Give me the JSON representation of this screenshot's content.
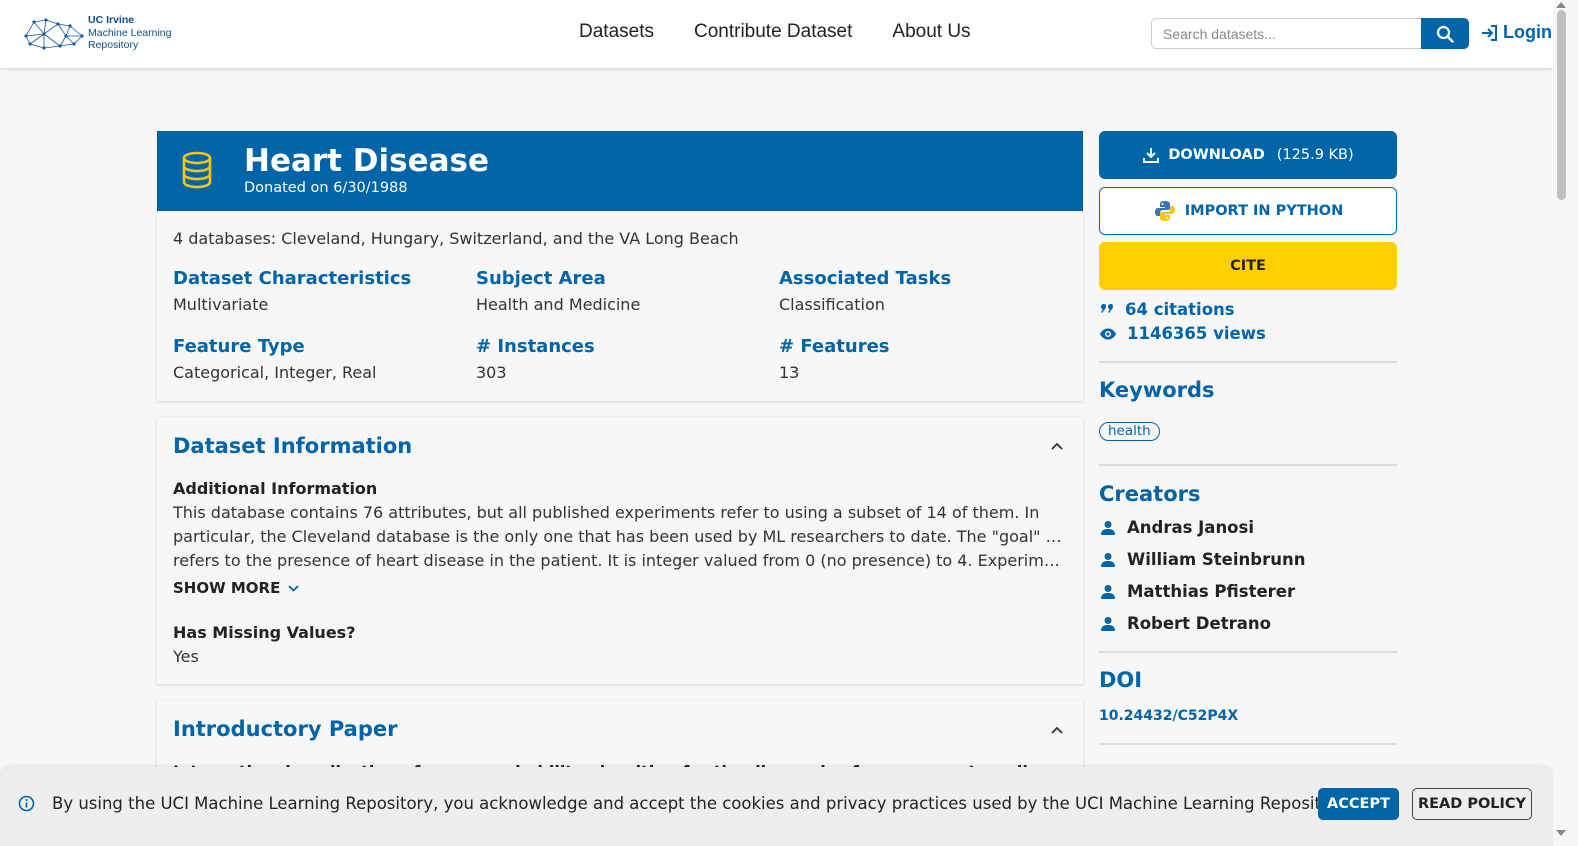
{
  "header": {
    "logo": {
      "line1": "UC Irvine",
      "line2": "Machine Learning",
      "line3": "Repository"
    },
    "nav": [
      "Datasets",
      "Contribute Dataset",
      "About Us"
    ],
    "search_placeholder": "Search datasets...",
    "login_label": "Login"
  },
  "dataset": {
    "title": "Heart Disease",
    "donated": "Donated on 6/30/1988",
    "description": "4 databases: Cleveland, Hungary, Switzerland, and the VA Long Beach",
    "attributes": [
      {
        "label": "Dataset Characteristics",
        "value": "Multivariate"
      },
      {
        "label": "Subject Area",
        "value": "Health and Medicine"
      },
      {
        "label": "Associated Tasks",
        "value": "Classification"
      },
      {
        "label": "Feature Type",
        "value": "Categorical, Integer, Real"
      },
      {
        "label": "# Instances",
        "value": "303"
      },
      {
        "label": "# Features",
        "value": "13"
      }
    ]
  },
  "info": {
    "title": "Dataset Information",
    "additional_label": "Additional Information",
    "lines": [
      "This database contains 76 attributes, but all published experiments refer to using a subset of 14 of them.  In",
      "particular, the Cleveland database is the only one that has been used by ML researchers to date.  The \"goal\" field",
      "refers to the presence of heart disease in the patient.  It is integer valued from 0 (no presence) to 4. Experiments with the Cleveland database have concentrated on simply attempting to distinguish presence"
    ],
    "show_more": "SHOW MORE",
    "missing_label": "Has Missing Values?",
    "missing_value": "Yes"
  },
  "paper": {
    "title": "Introductory Paper",
    "cut_text": "International application of a new probability algorithm for the diagnosis of coronary artery disease"
  },
  "sidebar": {
    "download_label": "DOWNLOAD",
    "download_size": "(125.9 KB)",
    "import_label": "IMPORT IN PYTHON",
    "cite_label": "CITE",
    "citations": "64 citations",
    "views": "1146365 views",
    "keywords_title": "Keywords",
    "keywords": [
      "health"
    ],
    "creators_title": "Creators",
    "creators": [
      "Andras Janosi",
      "William Steinbrunn",
      "Matthias Pfisterer",
      "Robert Detrano"
    ],
    "doi_title": "DOI",
    "doi": "10.24432/C52P4X"
  },
  "cookie": {
    "text": "By using the UCI Machine Learning Repository, you acknowledge and accept the cookies and privacy practices used by the UCI Machine Learning Repository.",
    "accept": "ACCEPT",
    "policy": "READ POLICY"
  },
  "colors": {
    "brand_blue": "#0064a8",
    "cite_yellow": "#ffcf00",
    "database_icon": "#f5c518"
  }
}
